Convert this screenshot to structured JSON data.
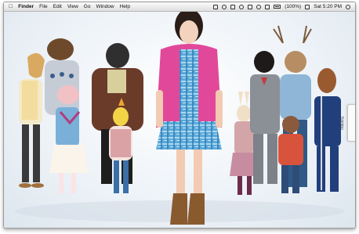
{
  "menubar": {
    "apple_icon": "apple-logo-icon",
    "items": [
      "Finder",
      "File",
      "Edit",
      "View",
      "Go",
      "Window",
      "Help"
    ],
    "status": {
      "battery_text": "(100%)",
      "clock": "Sat 5:20 PM"
    }
  },
  "side_tab": {
    "label": "Yojimbo"
  },
  "colors": {
    "cardigan": "#e2489a",
    "skirt_plaid": "#5aa9d8",
    "menubar": "#e9e9e9"
  }
}
